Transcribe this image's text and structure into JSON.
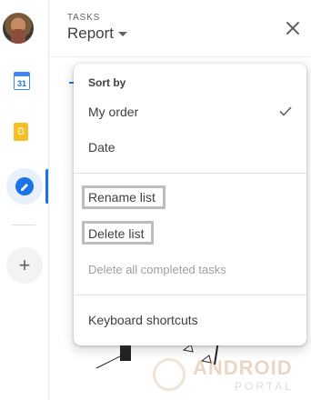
{
  "header": {
    "label": "TASKS",
    "title": "Report"
  },
  "rail": {
    "calendar_day": "31",
    "add_label": "+"
  },
  "menu": {
    "sort_label": "Sort by",
    "items": [
      {
        "label": "My order",
        "selected": true
      },
      {
        "label": "Date",
        "selected": false
      }
    ],
    "rename": "Rename list",
    "delete": "Delete list",
    "delete_completed": "Delete all completed tasks",
    "shortcuts": "Keyboard shortcuts"
  },
  "watermark": {
    "title": "ANDROID",
    "subtitle": "PORTAL"
  },
  "colors": {
    "accent": "#1a73e8",
    "highlight_box": "#bdbdbd",
    "disabled_text": "#9aa0a6"
  }
}
